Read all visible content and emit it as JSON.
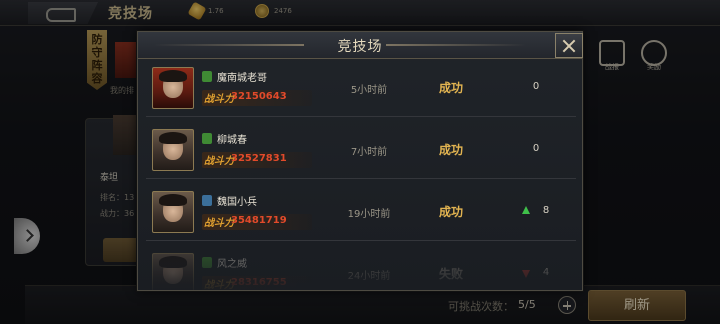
{
  "topbar": {
    "title": "竞技场",
    "gold_value": "1.76",
    "coin_value": "2476"
  },
  "background": {
    "defense_tag": "防守阵容",
    "my_label": "我的排",
    "card_name": "泰坦",
    "rank_label": "排名：13",
    "power_label": "战力：36",
    "btn_label": "挑",
    "icon1_label": "战报",
    "icon2_label": "奖励"
  },
  "modal": {
    "title": "竞技场",
    "power_prefix": "战斗力",
    "records": [
      {
        "vip": "VIP",
        "vip_color": "green",
        "name": "魔南城老哥",
        "power": "32150643",
        "time": "5小时前",
        "result": "成功",
        "rank_change": "0",
        "trend": "none",
        "avatar": "red"
      },
      {
        "vip": "VIP",
        "vip_color": "green",
        "name": "柳城春",
        "power": "32527831",
        "time": "7小时前",
        "result": "成功",
        "rank_change": "0",
        "trend": "none",
        "avatar": "normal"
      },
      {
        "vip": "VIP",
        "vip_color": "blue",
        "name": "魏国小兵",
        "power": "35481719",
        "time": "19小时前",
        "result": "成功",
        "rank_change": "8",
        "trend": "up",
        "avatar": "normal"
      },
      {
        "vip": "VIP",
        "vip_color": "green",
        "name": "风之威",
        "power": "28316755",
        "time": "24小时前",
        "result": "失败",
        "rank_change": "4",
        "trend": "down",
        "avatar": "normal"
      }
    ]
  },
  "bottombar": {
    "chance_label": "可挑战次数：",
    "chance_value": "5/5",
    "refresh_label": "刷新"
  },
  "colors": {
    "accent_gold": "#e2b451",
    "power_red": "#e24a2a",
    "up_green": "#3fc04a",
    "down_red": "#c03a30"
  }
}
